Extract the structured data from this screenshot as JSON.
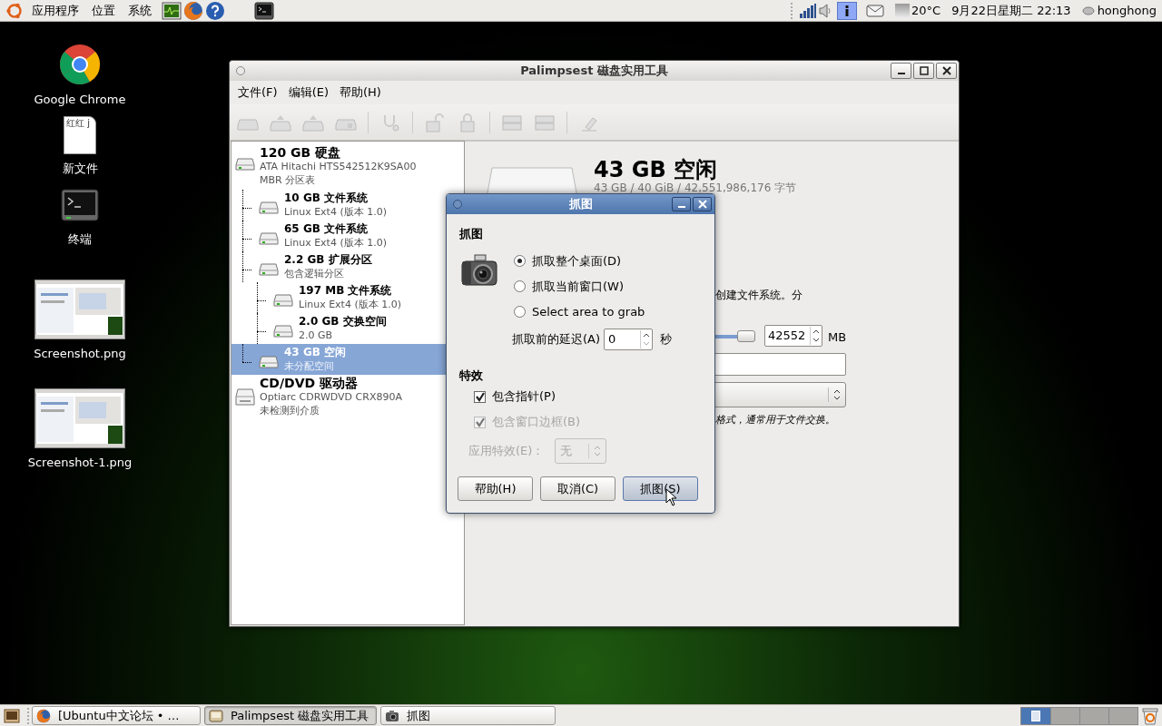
{
  "top_panel": {
    "menus": [
      "应用程序",
      "位置",
      "系统"
    ],
    "weather": "20°C",
    "clock": "9月22日星期二 22:13",
    "user": "honghong"
  },
  "desktop_icons": [
    {
      "kind": "chrome",
      "label": "Google Chrome"
    },
    {
      "kind": "document",
      "label": "新文件",
      "preview_text": "红红 j"
    },
    {
      "kind": "terminal",
      "label": "终端"
    },
    {
      "kind": "thumbnail",
      "label": "Screenshot.png"
    },
    {
      "kind": "thumbnail",
      "label": "Screenshot-1.png"
    }
  ],
  "window": {
    "title": "Palimpsest 磁盘实用工具",
    "menu": [
      "文件(F)",
      "编辑(E)",
      "帮助(H)"
    ],
    "tree": [
      {
        "kind": "disk",
        "title": "120 GB 硬盘",
        "lines": [
          "ATA Hitachi HTS542512K9SA00",
          "MBR 分区表"
        ],
        "selected": false,
        "children": [
          {
            "kind": "partition",
            "title": "10 GB 文件系统",
            "lines": [
              "Linux Ext4 (版本 1.0)"
            ],
            "selected": false
          },
          {
            "kind": "partition",
            "title": "65 GB 文件系统",
            "lines": [
              "Linux Ext4 (版本 1.0)"
            ],
            "selected": false
          },
          {
            "kind": "partition",
            "title": "2.2 GB 扩展分区",
            "lines": [
              "包含逻辑分区"
            ],
            "selected": false,
            "children": [
              {
                "kind": "partition",
                "title": "197 MB 文件系统",
                "lines": [
                  "Linux Ext4 (版本 1.0)"
                ],
                "selected": false
              },
              {
                "kind": "partition",
                "title": "2.0 GB 交换空间",
                "lines": [
                  "2.0 GB"
                ],
                "selected": false
              }
            ]
          },
          {
            "kind": "partition",
            "title": "43 GB 空闲",
            "lines": [
              "未分配空间"
            ],
            "selected": true
          }
        ]
      },
      {
        "kind": "optical",
        "title": "CD/DVD 驱动器",
        "lines": [
          "Optiarc CDRWDVD CRX890A",
          "未检测到介质"
        ],
        "selected": false
      }
    ],
    "details": {
      "heading": "43 GB 空闲",
      "size": "43 GB / 40 GiB / 42,551,986,176 字节",
      "partial_text": "创建文件系统。分",
      "size_slider": {
        "level": 1
      },
      "size_value": "42552",
      "size_unit": "MB",
      "type_hint": "格式，通常用于文件交换。"
    }
  },
  "dialog": {
    "title": "抓图",
    "section_grab": "抓图",
    "options": [
      {
        "label": "抓取整个桌面(D)",
        "selected": true
      },
      {
        "label": "抓取当前窗口(W)",
        "selected": false
      },
      {
        "label": "Select area to grab",
        "selected": false
      }
    ],
    "delay_label": "抓取前的延迟(A)",
    "delay_value": "0",
    "delay_unit": "秒",
    "section_effects": "特效",
    "checkboxes": [
      {
        "label": "包含指针(P)",
        "checked": true,
        "disabled": false
      },
      {
        "label": "包含窗口边框(B)",
        "checked": true,
        "disabled": true
      }
    ],
    "effect_label": "应用特效(E)：",
    "effect_value": "无",
    "effect_disabled": true,
    "buttons": [
      {
        "label": "帮助(H)",
        "hover": false
      },
      {
        "label": "取消(C)",
        "hover": false
      },
      {
        "label": "抓图(S)",
        "hover": true
      }
    ]
  },
  "taskbar": {
    "tasks": [
      {
        "kind": "firefox",
        "label": "[Ubuntu中文论坛 • …",
        "selected": false
      },
      {
        "kind": "disk",
        "label": "Palimpsest 磁盘实用工具",
        "selected": true
      },
      {
        "kind": "camera",
        "label": "抓图",
        "selected": false
      }
    ],
    "workspaces": [
      {
        "selected": true
      },
      {
        "selected": false
      },
      {
        "selected": false
      },
      {
        "selected": false
      }
    ]
  }
}
